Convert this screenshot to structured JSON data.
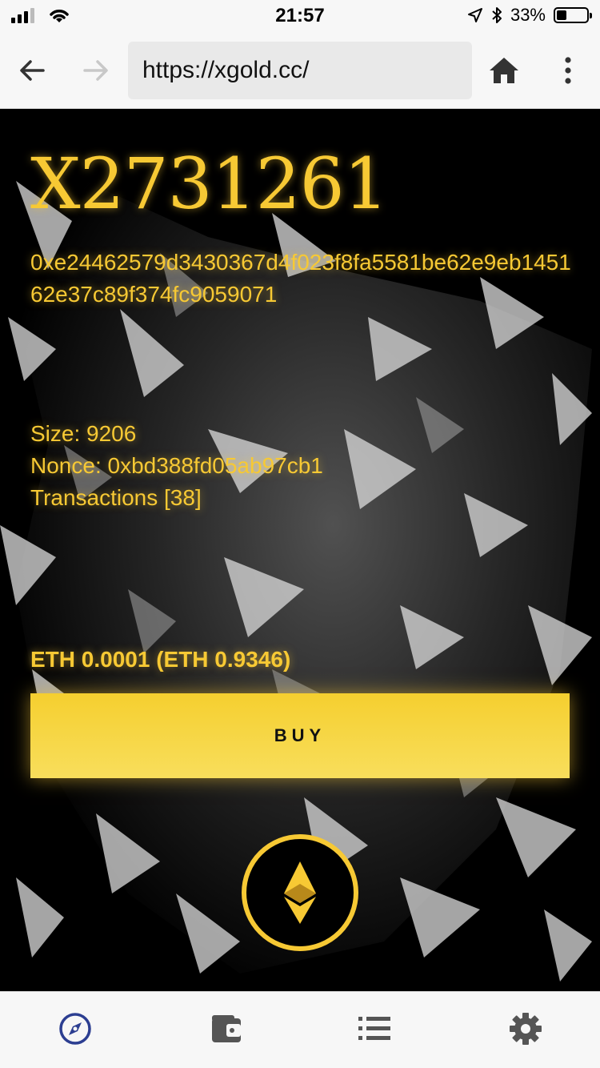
{
  "status_bar": {
    "time": "21:57",
    "battery_percent": "33%",
    "battery_level": 0.33
  },
  "browser": {
    "url": "https://xgold.cc/"
  },
  "block": {
    "title": "X2731261",
    "hash": "0xe24462579d3430367d4f023f8fa5581be62e9eb145162e37c89f374fc9059071",
    "size": "Size: 9206",
    "nonce": "Nonce: 0xbd388fd05ab97cb1",
    "transactions": "Transactions [38]"
  },
  "purchase": {
    "price": "ETH 0.0001 (ETH 0.9346)",
    "buy_label": "BUY"
  },
  "colors": {
    "gold": "#f7c934",
    "tab_active": "#2c3e91",
    "tab_inactive": "#555555"
  },
  "tabs": [
    {
      "icon": "compass-icon",
      "active": true
    },
    {
      "icon": "wallet-icon",
      "active": false
    },
    {
      "icon": "list-icon",
      "active": false
    },
    {
      "icon": "gear-icon",
      "active": false
    }
  ]
}
